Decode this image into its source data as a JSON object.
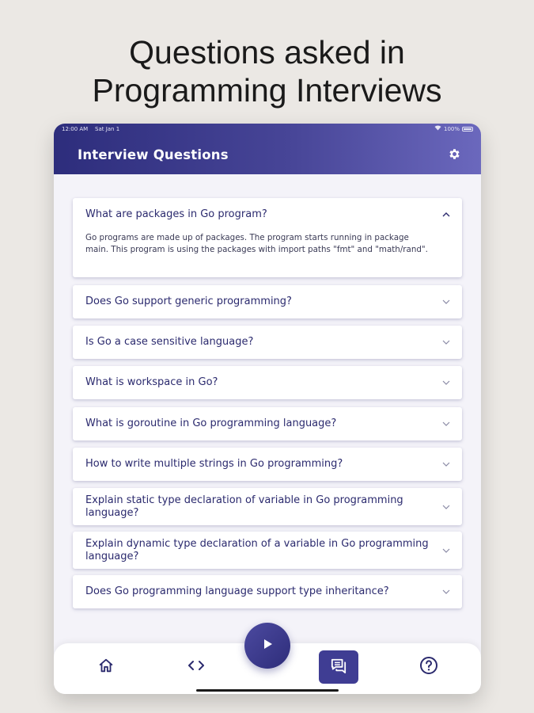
{
  "headline": {
    "line1": "Questions asked in",
    "line2": "Programming Interviews"
  },
  "status": {
    "time": "12:00 AM",
    "date": "Sat Jan 1",
    "battery": "100%"
  },
  "app": {
    "title": "Interview Questions"
  },
  "questions": [
    {
      "question": "What are packages in Go program?",
      "expanded": true,
      "answer": "Go programs are made up of packages. The program starts running in package main. This program is using the packages with import paths \"fmt\" and \"math/rand\"."
    },
    {
      "question": "Does Go support generic programming?",
      "expanded": false
    },
    {
      "question": "Is Go a case sensitive language?",
      "expanded": false
    },
    {
      "question": "What is workspace in Go?",
      "expanded": false
    },
    {
      "question": "What is goroutine in Go programming language?",
      "expanded": false
    },
    {
      "question": "How to write multiple strings in Go programming?",
      "expanded": false
    },
    {
      "question": "Explain static type declaration of variable in Go programming language?",
      "expanded": false
    },
    {
      "question": "Explain dynamic type declaration of a variable in Go programming language?",
      "expanded": false
    },
    {
      "question": "Does Go programming language support type inheritance?",
      "expanded": false
    }
  ],
  "nav": {
    "items": [
      {
        "icon": "home-icon",
        "active": false
      },
      {
        "icon": "code-icon",
        "active": false
      },
      {
        "icon": "chat-icon",
        "active": true
      },
      {
        "icon": "help-icon",
        "active": false
      }
    ],
    "fab_icon": "play-icon"
  },
  "colors": {
    "primary": "#3f3d93",
    "appbar_start": "#2d2d7c",
    "appbar_end": "#6b68bd",
    "question_text": "#2b2a6e",
    "background": "#ebe8e4"
  }
}
